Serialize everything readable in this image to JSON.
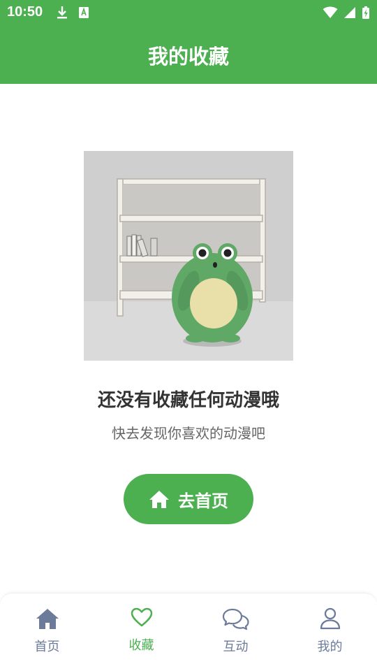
{
  "status_bar": {
    "time": "10:50",
    "icons": [
      "download-icon",
      "font-app-icon",
      "wifi-icon",
      "signal-icon",
      "battery-charging-icon"
    ]
  },
  "header": {
    "title": "我的收藏"
  },
  "empty_state": {
    "illustration": "frog-bookshelf-illustration",
    "title": "还没有收藏任何动漫哦",
    "subtitle": "快去发现你喜欢的动漫吧",
    "button_label": "去首页",
    "button_icon": "home-icon"
  },
  "bottom_nav": {
    "items": [
      {
        "label": "首页",
        "icon": "home-icon",
        "active": false
      },
      {
        "label": "收藏",
        "icon": "heart-icon",
        "active": true
      },
      {
        "label": "互动",
        "icon": "chat-icon",
        "active": false
      },
      {
        "label": "我的",
        "icon": "user-icon",
        "active": false
      }
    ]
  },
  "colors": {
    "primary": "#4caf50",
    "nav_inactive": "#6b7b99",
    "title_text": "#333333",
    "subtitle_text": "#666666"
  }
}
